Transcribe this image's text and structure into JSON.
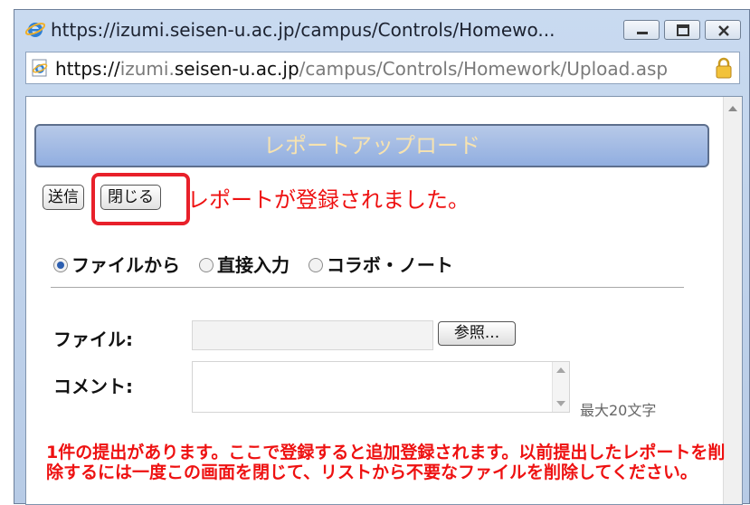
{
  "window": {
    "title": "https://izumi.seisen-u.ac.jp/campus/Controls/Homewo...",
    "address_dark_1": "https://",
    "address_light_1": "izumi.",
    "address_dark_2": "seisen-u.ac.jp",
    "address_light_2": "/campus/Controls/Homework/Upload.asp"
  },
  "page": {
    "banner_title": "レポートアップロード",
    "send_button": "送信",
    "close_button": "閉じる",
    "status_message": "レポートが登録されました。",
    "radio_options": [
      {
        "label": "ファイルから",
        "selected": true
      },
      {
        "label": "直接入力",
        "selected": false
      },
      {
        "label": "コラボ・ノート",
        "selected": false
      }
    ],
    "file_label": "ファイル:",
    "browse_button": "参照...",
    "comment_label": "コメント:",
    "comment_hint": "最大20文字",
    "notice_text": "1件の提出があります。ここで登録すると追加登録されます。以前提出したレポートを削除するには一度この画面を閉じて、リストから不要なファイルを削除してください。"
  },
  "colors": {
    "status_red": "#ee1111",
    "highlight_red": "#e8202a",
    "banner_text": "#f7e3b0",
    "banner_bg": "#91aee0"
  }
}
